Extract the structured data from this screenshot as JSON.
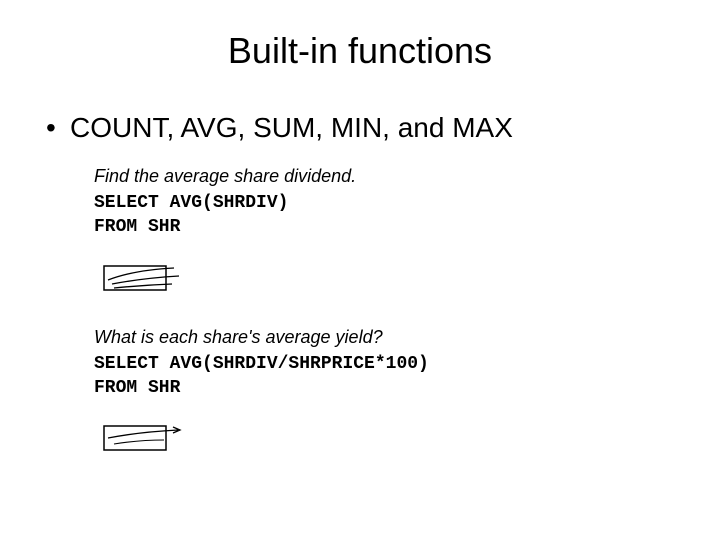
{
  "title": "Built-in functions",
  "bullet": {
    "text": "COUNT, AVG, SUM, MIN, and MAX"
  },
  "example1": {
    "prompt": "Find the average share dividend.",
    "line1": "SELECT AVG(SHRDIV)",
    "line2": "FROM SHR"
  },
  "example2": {
    "prompt": "What is each share's average yield?",
    "line1": "SELECT AVG(SHRDIV/SHRPRICE*100)",
    "line2": "FROM SHR"
  }
}
